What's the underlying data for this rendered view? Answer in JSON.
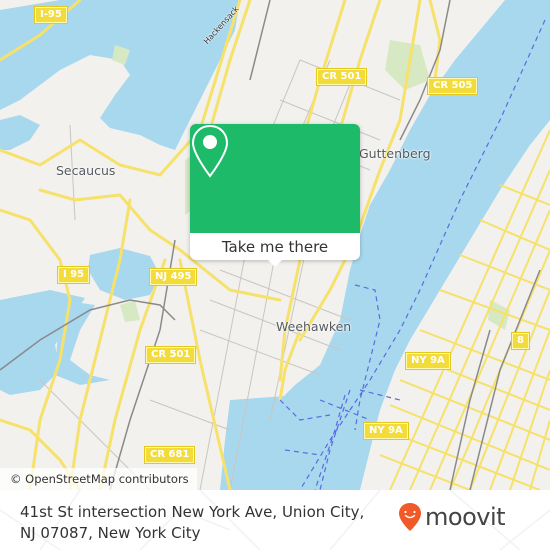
{
  "map": {
    "colors": {
      "land": "#f2f1ee",
      "water": "#a8d8ee",
      "park": "#d7e9c3",
      "road_major": "#f6e16a",
      "road_minor": "#c9c6c0",
      "rail": "#8a8a8a",
      "ferry": "#5a6be0",
      "shield": "#f3dc3a"
    },
    "places": [
      {
        "id": "secaucus",
        "label": "Secaucus"
      },
      {
        "id": "guttenberg",
        "label": "Guttenberg"
      },
      {
        "id": "weehawken",
        "label": "Weehawken"
      }
    ],
    "river_label": "Hackensack",
    "shields": [
      {
        "id": "i95-top",
        "label": "I-95"
      },
      {
        "id": "cr501-top",
        "label": "CR 501"
      },
      {
        "id": "cr505",
        "label": "CR 505"
      },
      {
        "id": "i95-mid",
        "label": "I 95"
      },
      {
        "id": "nj495",
        "label": "NJ 495"
      },
      {
        "id": "cr501-mid",
        "label": "CR 501"
      },
      {
        "id": "cr681",
        "label": "CR 681"
      },
      {
        "id": "ny9a-top",
        "label": "NY 9A"
      },
      {
        "id": "ny9a-bottom",
        "label": "NY 9A"
      },
      {
        "id": "route8",
        "label": "8"
      }
    ],
    "attribution": "© OpenStreetMap contributors"
  },
  "popup": {
    "icon": "map-pin-icon",
    "button_label": "Take me there",
    "color": "#1dba69"
  },
  "footer": {
    "address": "41st St intersection New York Ave, Union City, NJ 07087, New York City",
    "brand": "moovit",
    "brand_color": "#f05a28"
  }
}
